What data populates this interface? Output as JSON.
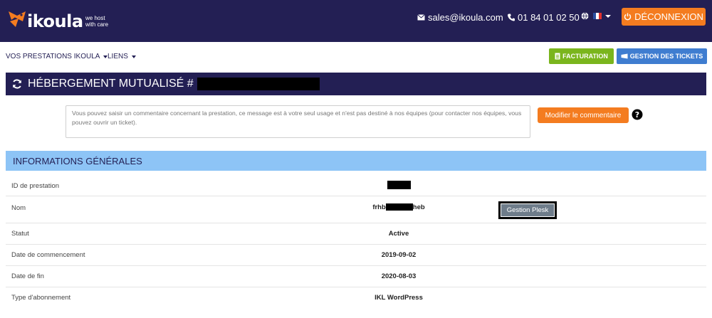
{
  "header": {
    "logo_text": "ikoula",
    "logo_tagline": "we host with care",
    "email": "sales@ikoula.com",
    "phone": "01 84 01 02 50",
    "logout_label": "DÉCONNEXION",
    "flag_icon": "flag-fr-icon",
    "colors": {
      "bar": "#231f54",
      "accent": "#f47c20"
    }
  },
  "nav": {
    "prestations": "VOS PRESTATIONS IKOULA",
    "liens": "LIENS",
    "facturation": "FACTURATION",
    "tickets": "GESTION DES TICKETS"
  },
  "title": {
    "text": "HÉBERGEMENT MUTUALISÉ #"
  },
  "comment": {
    "placeholder": "Vous pouvez saisir un commentaire concernant la prestation, ce message est à votre seul usage et n'est pas destiné à nos équipes (pour contacter nos équipes, vous pouvez ouvrir un ticket).",
    "button": "Modifier le commentaire"
  },
  "section": {
    "title": "INFORMATIONS GÉNÉRALES",
    "rows": [
      {
        "label": "ID de prestation",
        "value": ""
      },
      {
        "label": "Nom",
        "value_prefix": "frhb",
        "value_suffix": "heb",
        "action": "Gestion Plesk"
      },
      {
        "label": "Statut",
        "value": "Active"
      },
      {
        "label": "Date de commencement",
        "value": "2019-09-02"
      },
      {
        "label": "Date de fin",
        "value": "2020-08-03"
      },
      {
        "label": "Type d'abonnement",
        "value": "IKL WordPress"
      }
    ]
  }
}
